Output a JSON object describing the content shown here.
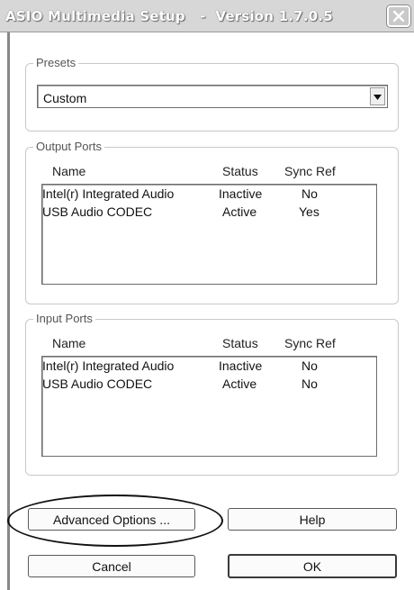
{
  "window": {
    "title": "ASIO Multimedia Setup   -  Version 1.7.0.5",
    "close_icon": "close-icon"
  },
  "presets": {
    "label": "Presets",
    "selected": "Custom"
  },
  "output_ports": {
    "label": "Output Ports",
    "headers": {
      "name": "Name",
      "status": "Status",
      "sync": "Sync Ref"
    },
    "rows": [
      {
        "name": "Intel(r) Integrated Audio",
        "status": "Inactive",
        "sync": "No"
      },
      {
        "name": "USB Audio CODEC",
        "status": "Active",
        "sync": "Yes"
      }
    ]
  },
  "input_ports": {
    "label": "Input Ports",
    "headers": {
      "name": "Name",
      "status": "Status",
      "sync": "Sync Ref"
    },
    "rows": [
      {
        "name": "Intel(r) Integrated Audio",
        "status": "Inactive",
        "sync": "No"
      },
      {
        "name": "USB Audio CODEC",
        "status": "Active",
        "sync": "No"
      }
    ]
  },
  "buttons": {
    "advanced": "Advanced Options ...",
    "help": "Help",
    "cancel": "Cancel",
    "ok": "OK"
  }
}
